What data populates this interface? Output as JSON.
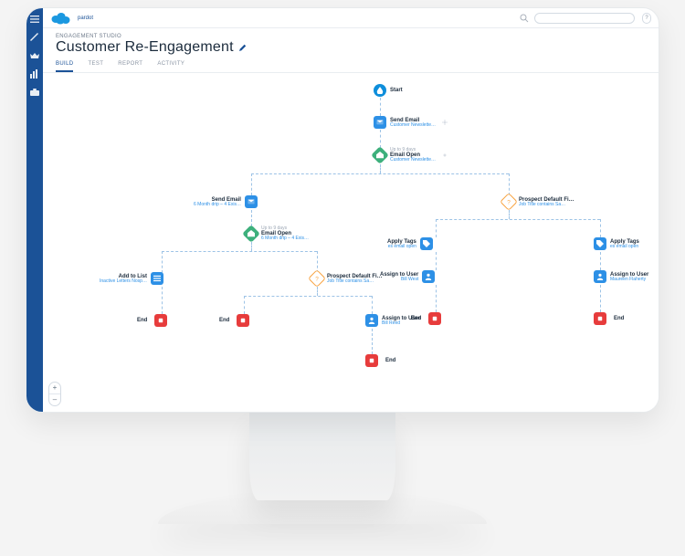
{
  "brand": {
    "name": "pardot"
  },
  "header": {
    "breadcrumb": "ENGAGEMENT STUDIO",
    "title": "Customer Re-Engagement"
  },
  "tabs": [
    {
      "id": "build",
      "label": "BUILD",
      "active": true
    },
    {
      "id": "test",
      "label": "TEST"
    },
    {
      "id": "report",
      "label": "REPORT"
    },
    {
      "id": "activity",
      "label": "ACTIVITY"
    }
  ],
  "help_label": "?",
  "zoom": {
    "in": "+",
    "out": "–"
  },
  "end_label": "End",
  "nodes": {
    "start": {
      "title": "Start"
    },
    "send1": {
      "title": "Send Email",
      "sub": "Customer Newslette…"
    },
    "open1": {
      "meta": "Up to 9 days",
      "title": "Email Open",
      "sub": "Customer Newslette…"
    },
    "send2": {
      "title": "Send Email",
      "sub": "6 Month drip – 4 Exis…"
    },
    "open2": {
      "meta": "Up to 9 days",
      "title": "Email Open",
      "sub": "6 Month drip – 4 Exis…"
    },
    "addlist": {
      "title": "Add to List",
      "sub": "Inactive Letters Nosp…"
    },
    "rule1": {
      "title": "Prospect Default Fi…",
      "sub": "Job Title contains Sa…"
    },
    "assign1": {
      "title": "Assign to User",
      "sub": "Bill Reed"
    },
    "rule2": {
      "title": "Prospect Default Fi…",
      "sub": "Job Title contains Sa…"
    },
    "tags1": {
      "title": "Apply Tags",
      "sub": "es email open"
    },
    "assign2": {
      "title": "Assign to User",
      "sub": "Bill West"
    },
    "tags2": {
      "title": "Apply Tags",
      "sub": "es email open"
    },
    "assign3": {
      "title": "Assign to User",
      "sub": "Maureen Flaherty"
    }
  }
}
